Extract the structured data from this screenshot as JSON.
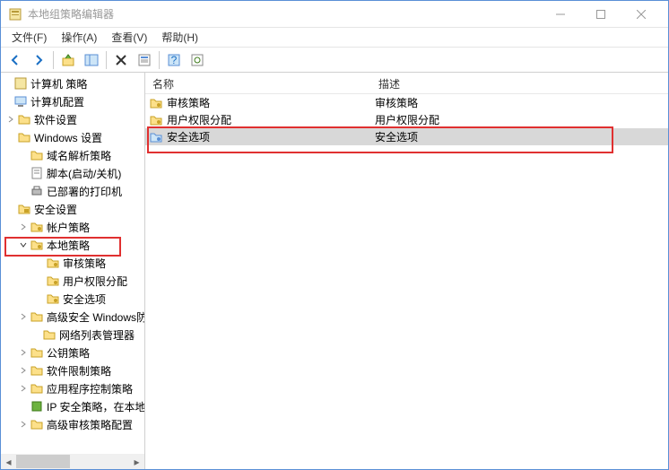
{
  "window": {
    "title": "本地组策略编辑器"
  },
  "menu": {
    "file": "文件(F)",
    "action": "操作(A)",
    "view": "查看(V)",
    "help": "帮助(H)"
  },
  "tree": {
    "root": "计算机 策略",
    "computer_config": "计算机配置",
    "software_settings": "软件设置",
    "windows_settings": "Windows 设置",
    "dns_policy": "域名解析策略",
    "scripts": "脚本(启动/关机)",
    "printers": "已部署的打印机",
    "security_settings": "安全设置",
    "account_policies": "帐户策略",
    "local_policies": "本地策略",
    "audit_policy": "审核策略",
    "user_rights": "用户权限分配",
    "security_options": "安全选项",
    "adv_firewall": "高级安全 Windows防火墙",
    "netlist_mgr": "网络列表管理器",
    "public_key": "公钥策略",
    "software_restrict": "软件限制策略",
    "app_control": "应用程序控制策略",
    "ip_security": "IP 安全策略，在本地计算机",
    "adv_audit": "高级审核策略配置"
  },
  "columns": {
    "name": "名称",
    "desc": "描述"
  },
  "list": [
    {
      "name": "审核策略",
      "desc": "审核策略"
    },
    {
      "name": "用户权限分配",
      "desc": "用户权限分配"
    },
    {
      "name": "安全选项",
      "desc": "安全选项"
    }
  ]
}
